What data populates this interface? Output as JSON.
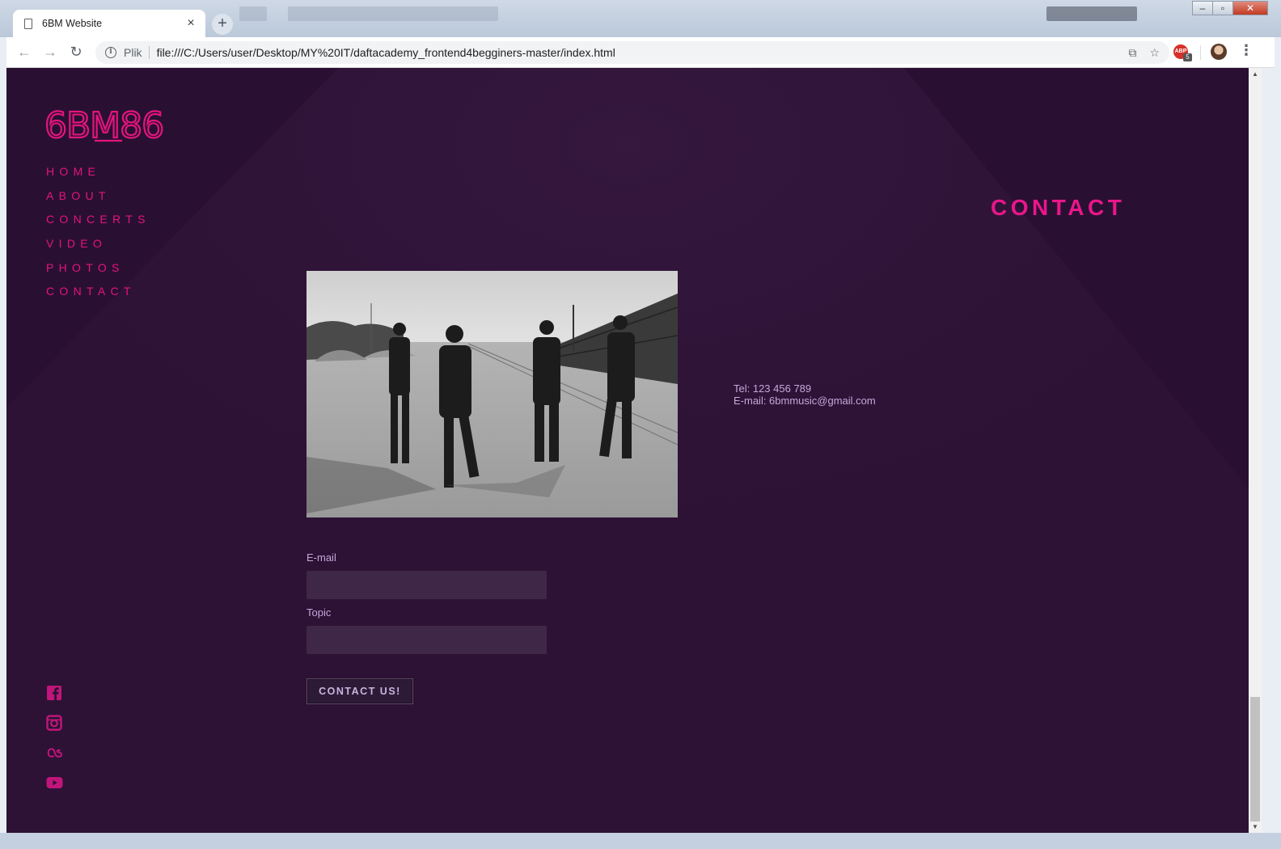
{
  "browser": {
    "tab_title": "6BM Website",
    "tab_close": "×",
    "new_tab": "+",
    "omnibox_scheme": "Plik",
    "url": "file:///C:/Users/user/Desktop/MY%20IT/daftacademy_frontend4begginers-master/index.html",
    "icons": [
      "page-icon",
      "back-icon",
      "forward-icon",
      "reload-icon",
      "info-icon",
      "translate-icon",
      "star-icon",
      "adblock-icon",
      "profile-avatar",
      "menu-icon"
    ],
    "adblock_label": "ABP",
    "adblock_count": "5",
    "back_glyph": "←",
    "forward_glyph": "→",
    "reload_glyph": "↻",
    "translate_glyph": "⧉",
    "star_glyph": "☆",
    "menu_glyph": "⋮",
    "win_minimize": "–",
    "win_maximize": "▫",
    "win_close": "✕"
  },
  "site": {
    "logo": "6BM86",
    "nav": [
      "HOME",
      "ABOUT",
      "CONCERTS",
      "VIDEO",
      "PHOTOS",
      "CONTACT"
    ],
    "social_icons": [
      "facebook-icon",
      "instagram-icon",
      "lastfm-icon",
      "youtube-icon"
    ],
    "section_title": "CONTACT",
    "photo_alt": "band photo",
    "contact": {
      "tel": "Tel: 123 456 789",
      "email": "E-mail: 6bmmusic@gmail.com"
    },
    "form": {
      "email_label": "E-mail",
      "email_value": "",
      "topic_label": "Topic",
      "topic_value": "",
      "submit_label": "CONTACT US!"
    }
  },
  "colors": {
    "page_bg": "#2d1235",
    "accent": "#e4147d",
    "text_muted": "#c3a8d9",
    "input_bg": "#3f2748"
  }
}
